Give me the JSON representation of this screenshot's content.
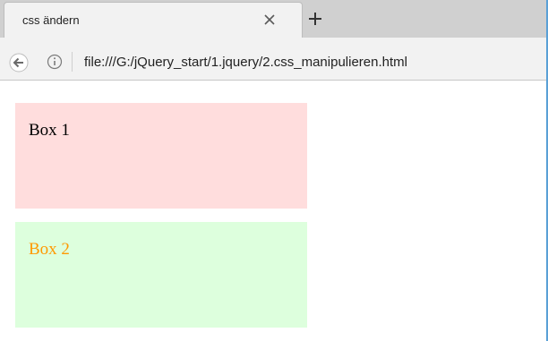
{
  "browser": {
    "tab": {
      "title": "css ändern",
      "close_icon": "close-icon"
    },
    "new_tab_icon": "plus-icon",
    "toolbar": {
      "back_icon": "back-arrow-icon",
      "info_icon": "info-icon",
      "url": "file:///G:/jQuery_start/1.jquery/2.css_manipulieren.html"
    }
  },
  "page": {
    "boxes": [
      {
        "label": "Box 1",
        "background": "#ffdddd",
        "text_color": "#000000"
      },
      {
        "label": "Box 2",
        "background": "#ddffdd",
        "text_color": "#ff9900"
      }
    ]
  },
  "colors": {
    "tabstrip": "#d0d0d0",
    "toolbar": "#f2f2f2",
    "window_edge": "#5aa0d6"
  }
}
